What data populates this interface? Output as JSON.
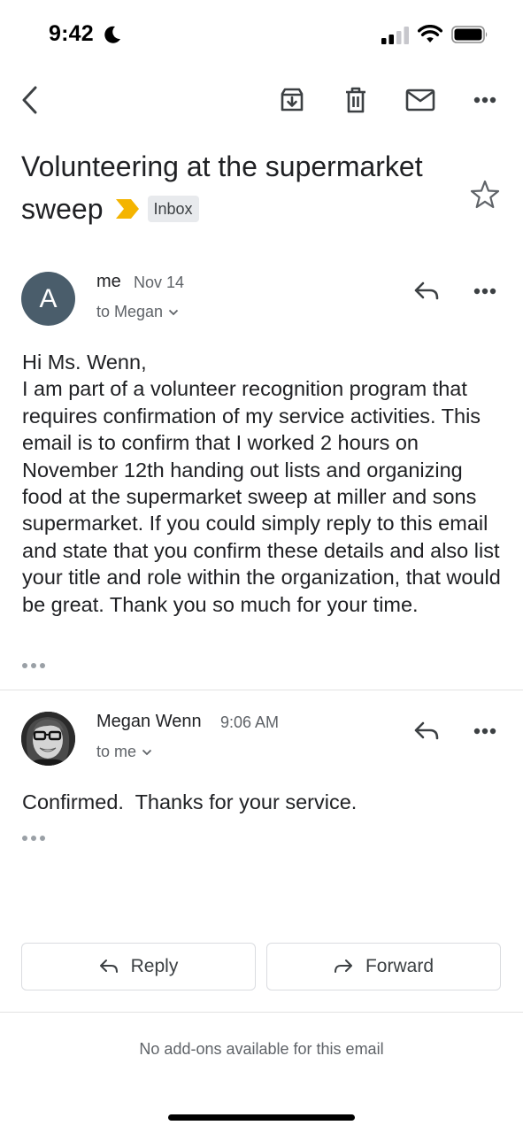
{
  "status_bar": {
    "time": "9:42",
    "icons": [
      "moon-icon",
      "cellular-signal-icon",
      "wifi-icon",
      "battery-icon"
    ]
  },
  "toolbar": {
    "icons": [
      "back-arrow-icon",
      "archive-icon",
      "trash-icon",
      "mark-unread-icon",
      "more-horizontal-icon"
    ]
  },
  "email": {
    "subject": "Volunteering at the supermarket sweep",
    "label": "Inbox",
    "importance_color": "#f4b400"
  },
  "messages": [
    {
      "avatar_letter": "A",
      "avatar_color": "#4a5d6b",
      "sender": "me",
      "date": "Nov 14",
      "recipient": "to Megan",
      "body": "Hi Ms. Wenn,\nI am part of a volunteer recognition program that requires confirmation of my service activities. This email is to confirm that I worked 2 hours on November 12th handing out lists and organizing food at the supermarket sweep at miller and sons supermarket. If you could simply reply to this email and state that you confirm these details and also list your title and role within the organization, that would be great. Thank you so much for your time."
    },
    {
      "sender": "Megan Wenn",
      "date": "9:06 AM",
      "recipient": "to me",
      "body": "Confirmed.  Thanks for your service."
    }
  ],
  "actions": {
    "reply": "Reply",
    "forward": "Forward"
  },
  "footer": {
    "addons_text": "No add-ons available for this email"
  }
}
